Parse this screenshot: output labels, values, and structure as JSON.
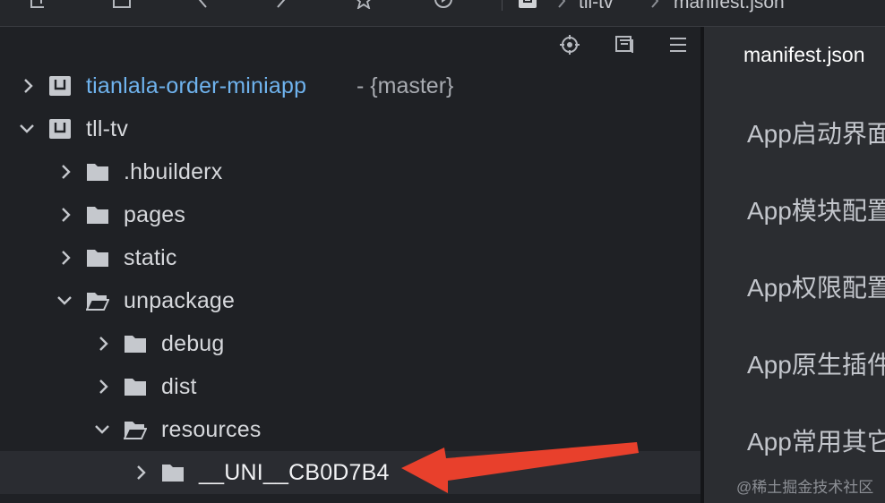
{
  "toolbar": {
    "icons": [
      "new-file-icon",
      "window-icon",
      "back-icon",
      "edit-icon",
      "star-icon",
      "run-icon"
    ]
  },
  "breadcrumb": {
    "project": "tll-tv",
    "file": "manifest.json"
  },
  "sidebar": {
    "tools": [
      "locate-icon",
      "collapse-icon",
      "menu-icon"
    ],
    "tree": [
      {
        "label": "tianlala-order-miniapp",
        "branch": "- {master}",
        "type": "project",
        "expanded": false
      },
      {
        "label": "tll-tv",
        "type": "project",
        "expanded": true
      },
      {
        "label": ".hbuilderx",
        "type": "folder",
        "expanded": false
      },
      {
        "label": "pages",
        "type": "folder",
        "expanded": false
      },
      {
        "label": "static",
        "type": "folder",
        "expanded": false
      },
      {
        "label": "unpackage",
        "type": "folder",
        "expanded": true
      },
      {
        "label": "debug",
        "type": "folder",
        "expanded": false
      },
      {
        "label": "dist",
        "type": "folder",
        "expanded": false
      },
      {
        "label": "resources",
        "type": "folder",
        "expanded": true
      },
      {
        "label": "__UNI__CB0D7B4",
        "type": "folder",
        "expanded": false,
        "selected": true
      }
    ]
  },
  "editor": {
    "title": "manifest.json",
    "items": [
      "App启动界面",
      "App模块配置",
      "App权限配置",
      "App原生插件",
      "App常用其它"
    ]
  },
  "watermark": "@稀土掘金技术社区",
  "colors": {
    "project_link": "#6fb3ee",
    "annotation_arrow": "#e8402c"
  }
}
